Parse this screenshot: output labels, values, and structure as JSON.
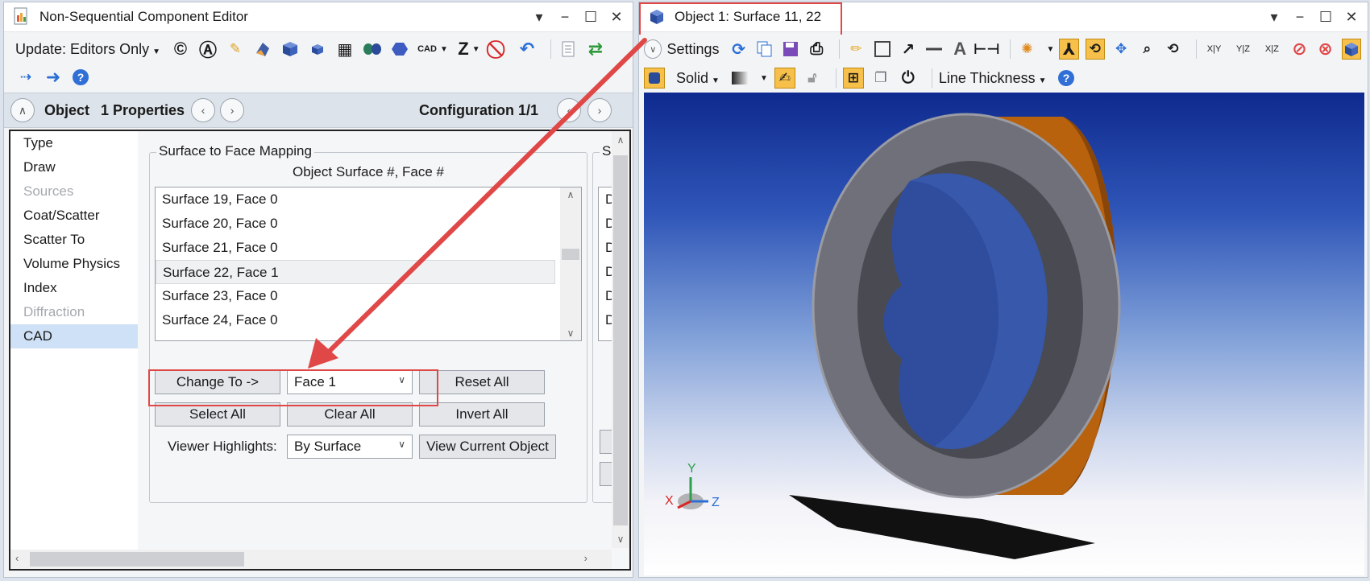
{
  "left_window": {
    "title": "Non-Sequential Component Editor",
    "toolbar": {
      "update_label": "Update: Editors Only",
      "cad_label": "CAD",
      "z_label": "Z"
    },
    "propbar": {
      "object_label": "Object",
      "properties_label": "1 Properties",
      "config_label": "Configuration 1/1"
    },
    "nav_items": [
      "Type",
      "Draw",
      "Sources",
      "Coat/Scatter",
      "Scatter To",
      "Volume Physics",
      "Index",
      "Diffraction",
      "CAD"
    ],
    "mapping": {
      "group_title": "Surface to Face Mapping",
      "header": "Object Surface #, Face #",
      "rows": [
        "Surface 19, Face 0",
        "Surface 20, Face 0",
        "Surface 21, Face 0",
        "Surface 22, Face 1",
        "Surface 23, Face 0",
        "Surface 24, Face 0"
      ],
      "selected_row": "Surface 22, Face 1"
    },
    "right_group_title_partial": "Sc",
    "right_list_partial": [
      "D",
      "D",
      "D",
      "D",
      "D",
      "D"
    ],
    "buttons": {
      "change_to": "Change To ->",
      "face_value": "Face 1",
      "reset_all": "Reset All",
      "select_all": "Select All",
      "clear_all": "Clear All",
      "invert_all": "Invert All",
      "viewer_highlights_label": "Viewer Highlights:",
      "viewer_highlights_value": "By Surface",
      "view_current_object": "View Current Object"
    }
  },
  "right_window": {
    "title": "Object 1: Surface 11, 22",
    "toolbar1": {
      "settings_label": "Settings",
      "axis_labels": [
        "X|Y",
        "Y|Z",
        "X|Z"
      ]
    },
    "toolbar2": {
      "solid_label": "Solid",
      "line_thickness_label": "Line Thickness"
    },
    "axes": {
      "x": "X",
      "y": "Y",
      "z": "Z"
    }
  },
  "colors": {
    "highlight_red": "#e04848",
    "ring_grey": "#6f7079",
    "ring_orange": "#b8620e",
    "accent_blue": "#2f6fd6",
    "viewport_top": "#0f2a8f"
  }
}
